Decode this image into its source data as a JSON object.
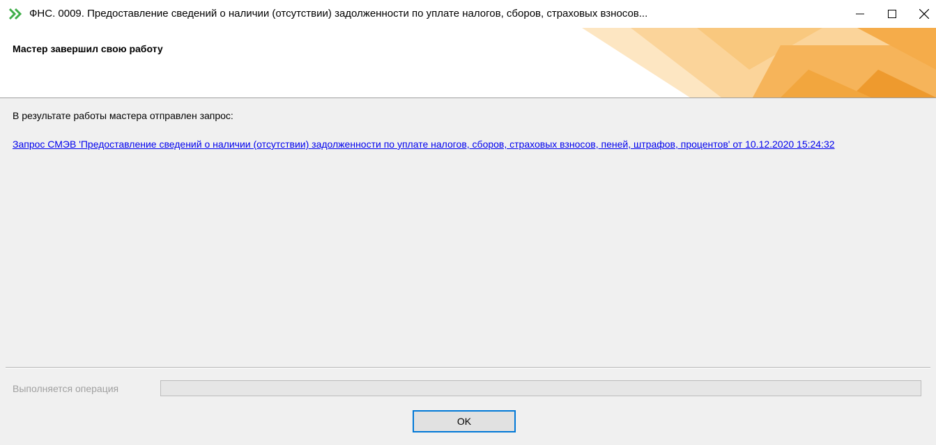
{
  "window": {
    "title": "ФНС. 0009. Предоставление сведений о наличии (отсутствии) задолженности по уплате налогов, сборов, страховых взносов..."
  },
  "header": {
    "title": "Мастер завершил свою работу"
  },
  "content": {
    "result_label": "В результате работы мастера отправлен запрос:",
    "link_text": "Запрос СМЭВ 'Предоставление сведений о наличии (отсутствии) задолженности по уплате налогов, сборов, страховых взносов, пеней, штрафов, процентов' от 10.12.2020 15:24:32"
  },
  "footer": {
    "operation_label": "Выполняется операция",
    "progress": 0,
    "ok_label": "OK"
  },
  "icons": {
    "app": "double-chevron-right-icon",
    "minimize": "minimize-icon",
    "maximize": "maximize-icon",
    "close": "close-icon"
  },
  "colors": {
    "accent_green": "#3fae49",
    "header_orange": "#f2a33a",
    "link": "#0000ee",
    "button_focus": "#0078d7"
  }
}
